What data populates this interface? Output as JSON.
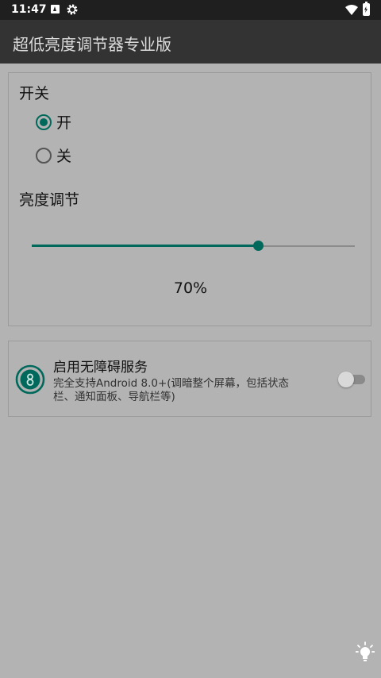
{
  "status_bar": {
    "time": "11:47",
    "icons": [
      "notification-a-icon",
      "gear-icon",
      "wifi-icon",
      "battery-charging-icon"
    ]
  },
  "app_bar": {
    "title": "超低亮度调节器专业版"
  },
  "power_section": {
    "title": "开关",
    "options": [
      {
        "label": "开",
        "selected": true
      },
      {
        "label": "关",
        "selected": false
      }
    ]
  },
  "brightness_section": {
    "title": "亮度调节",
    "slider_value": 0.7,
    "percent_text": "70%"
  },
  "accessibility_service": {
    "title": "启用无障碍服务",
    "description": "完全支持Android 8.0+(调暗整个屏幕，包括状态栏、通知面板、导航栏等)",
    "enabled": false
  },
  "colors": {
    "accent": "#00695c",
    "background": "#b3b3b3",
    "app_bar": "#333333",
    "status_bar": "#1f1f1f"
  }
}
